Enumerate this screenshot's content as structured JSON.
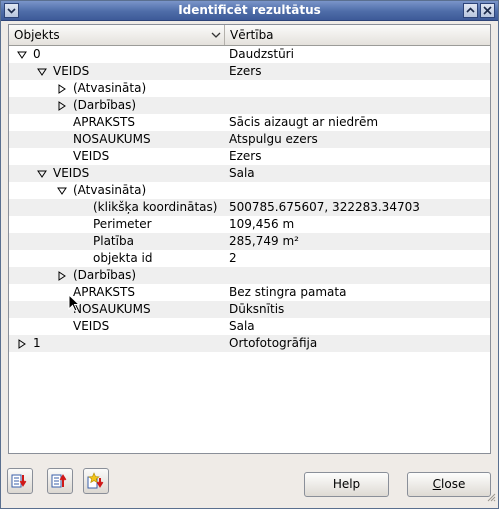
{
  "window": {
    "title": "Identificēt rezultātus",
    "icons": {
      "menu": "chevron-down-icon",
      "shade": "chevron-up-icon",
      "close": "close-icon"
    }
  },
  "tree": {
    "columns": {
      "object": "Objekts",
      "value": "Vērtība",
      "sort_icon": "chevron-down-icon"
    },
    "rows": [
      {
        "label": "0",
        "value": "Daudzstūri",
        "expander": "open"
      },
      {
        "label": "VEIDS",
        "value": "Ezers",
        "expander": "open"
      },
      {
        "label": "(Atvasināta)",
        "value": "",
        "expander": "closed"
      },
      {
        "label": "(Darbības)",
        "value": "",
        "expander": "closed"
      },
      {
        "label": "APRAKSTS",
        "value": "Sācis aizaugt ar niedrēm",
        "expander": "none"
      },
      {
        "label": "NOSAUKUMS",
        "value": "Atspulgu ezers",
        "expander": "none"
      },
      {
        "label": "VEIDS",
        "value": "Ezers",
        "expander": "none"
      },
      {
        "label": "VEIDS",
        "value": "Sala",
        "expander": "open"
      },
      {
        "label": "(Atvasināta)",
        "value": "",
        "expander": "open"
      },
      {
        "label": "(klikšķa koordinātas)",
        "value": "500785.675607, 322283.34703",
        "expander": "none"
      },
      {
        "label": "Perimeter",
        "value": "109,456 m",
        "expander": "none"
      },
      {
        "label": "Platība",
        "value": "285,749 m²",
        "expander": "none"
      },
      {
        "label": "objekta id",
        "value": "2",
        "expander": "none"
      },
      {
        "label": "(Darbības)",
        "value": "",
        "expander": "closed"
      },
      {
        "label": "APRAKSTS",
        "value": "Bez stingra pamata",
        "expander": "none"
      },
      {
        "label": "NOSAUKUMS",
        "value": "Dūksnītis",
        "expander": "none"
      },
      {
        "label": "VEIDS",
        "value": "Sala",
        "expander": "none"
      },
      {
        "label": "1",
        "value": "Ortofotogrāfija",
        "expander": "closed"
      }
    ]
  },
  "toolbar": {
    "icons": [
      "expand-all-icon",
      "collapse-all-icon",
      "highlight-feature-icon"
    ]
  },
  "buttons": {
    "help": "Help",
    "close_mnemonic": "C",
    "close_rest": "lose"
  },
  "colors": {
    "titlebar": "#4e6ca8",
    "title_text": "#ffffff",
    "window_bg": "#efebe7",
    "row_alt": "#efefef"
  }
}
